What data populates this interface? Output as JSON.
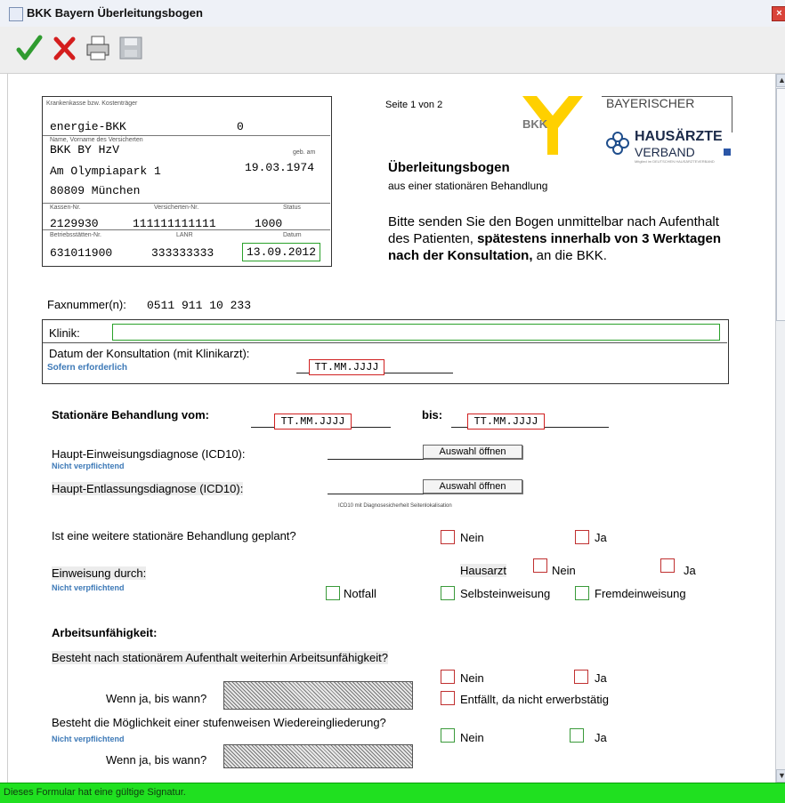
{
  "window": {
    "title": "BKK Bayern Überleitungsbogen",
    "close_icon": "×"
  },
  "toolbar": {
    "icons": [
      "check-icon",
      "cross-icon",
      "printer-icon",
      "save-icon"
    ]
  },
  "form": {
    "header": {
      "insurer_label": "Krankenkasse bzw. Kostenträger",
      "insurer": "energie-BKK",
      "insurer_code": "0",
      "name_label": "Name, Vorname des Versicherten",
      "name": "BKK BY HzV",
      "dob_label": "geb. am",
      "street": "Am Olympiapark 1",
      "dob": "19.03.1974",
      "city": "80809 München",
      "kassen_label": "Kassen-Nr.",
      "versicherten_label": "Versicherten-Nr.",
      "status_label": "Status",
      "kassen_nr": "2129930",
      "versicherten_nr": "111111111111",
      "status": "1000",
      "betriebs_label": "Betriebsstätten-Nr.",
      "lanr_label": "LANR",
      "datum_label": "Datum",
      "betriebs_nr": "631011900",
      "lanr": "333333333",
      "datum": "13.09.2012"
    },
    "page_info": "Seite 1 von 2",
    "bkk_logo_text": "BKK",
    "verband_logo": {
      "line1": "BAYERISCHER",
      "line2": "HAUSÄRZTE",
      "line3": "VERBAND",
      "tagline": "Mitglied im DEUTSCHEN HAUSÄRZTEVERBAND"
    },
    "heading": "Überleitungsbogen",
    "subheading": "aus einer stationären Behandlung",
    "instruction_part1": "Bitte senden Sie den Bogen unmittelbar nach Aufenthalt des Patienten, ",
    "instruction_bold": "spätestens innerhalb von 3 Werktagen nach der Konsultation,",
    "instruction_part2": " an die BKK.",
    "fax_label": "Faxnummer(n):",
    "fax_value": "0511 911 10 233",
    "klinik_label": "Klinik:",
    "klinik_value": "",
    "konsultation_label": "Datum der Konsultation (mit Klinikarzt):",
    "konsultation_hint": "Sofern erforderlich",
    "konsultation_value": "TT.MM.JJJJ",
    "stationaer_label": "Stationäre Behandlung vom:",
    "stationaer_from": "TT.MM.JJJJ",
    "bis_label": "bis:",
    "stationaer_to": "TT.MM.JJJJ",
    "haupt_einweisung_label": "Haupt-Einweisungsdiagnose (ICD10):",
    "haupt_einweisung_hint": "Nicht verpflichtend",
    "auswahl_label": "Auswahl öffnen",
    "haupt_entlassung_label": "Haupt-Entlassungsdiagnose (ICD10):",
    "icd_note": "ICD10    mit Diagnosesicherheit Seitenlokalisation",
    "weitere_question": "Ist eine weitere stationäre Behandlung geplant?",
    "nein": "Nein",
    "ja": "Ja",
    "einweisung_label": "Einweisung durch:",
    "einweisung_hint": "Nicht verpflichtend",
    "hausarzt": "Hausarzt",
    "notfall": "Notfall",
    "selbsteinweisung": "Selbsteinweisung",
    "fremdeinweisung": "Fremdeinweisung",
    "au_heading": "Arbeitsunfähigkeit:",
    "au_question": "Besteht nach stationärem Aufenthalt weiterhin Arbeitsunfähigkeit?",
    "wenn_ja": "Wenn ja, bis wann?",
    "entfaellt": "Entfällt, da nicht erwerbstätig",
    "stufen_question": "Besteht die Möglichkeit einer stufenweisen Wiedereingliederung?",
    "stufen_hint": "Nicht verpflichtend"
  },
  "status_bar": "Dieses Formular hat eine gültige Signatur."
}
